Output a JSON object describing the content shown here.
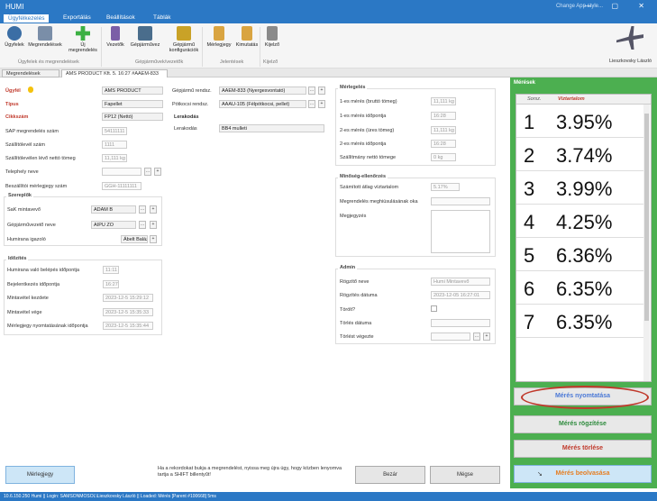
{
  "window": {
    "title": "HUMI",
    "user_text": "Change App style...",
    "controls": "— ▢ ✕"
  },
  "menu": {
    "items": [
      "Ügyfélkezelés",
      "Exportálás",
      "Beállítások",
      "Táblák"
    ]
  },
  "ribbon": {
    "buttons": [
      "Ügyfelek",
      "Megrendelések",
      "Új megrendelés",
      "Vezetők",
      "Gépjárművez",
      "Gépjármű konfigurációk",
      "Mérlegjegy",
      "Kimutatás",
      "Kijelző"
    ],
    "groups": [
      "Ügyfelek és megrendelések",
      "Gépjárművek/vezetők",
      "Jelentések",
      "Kijelző"
    ],
    "user": "Lieszkovsky László"
  },
  "tabs": [
    "Megrendelések",
    "AMS PRODUCT Kft. 5. 16:27 #AAEM-833"
  ],
  "form": {
    "ugyfel_label": "Ügyfél",
    "ugyfel_value": "AMS PRODUCT",
    "tipus_label": "Típus",
    "tipus_value": "Fapellet",
    "cikkszam_label": "Cikkszám",
    "cikkszam_value": "FP12 (Nettó)",
    "sap_label": "SAP megrendelés szám",
    "sap_value": "54111111",
    "szall_label": "Szállítólevél szám",
    "szall_value": "1111",
    "szallnetto_label": "Szállítólevélen lévő nettó tömeg",
    "szallnetto_value": "11,111 kg",
    "telephely_label": "Telephely neve",
    "beszall_label": "Beszállítói mérlegjegy szám",
    "beszall_value": "GGH-11111111",
    "szereplok_title": "Szereplők",
    "sap_mintavevo_label": "SaK mintavevő",
    "sap_mintavevo_value": "ADAM B",
    "gepjarmuvezeto_label": "Gépjárművezető neve",
    "gepjarmuvezeto_value": "AIPU ZO",
    "humirana_label": "Humirana igazoló",
    "humirana_value": "Ábelt Balázs",
    "gepjarmu_rendsz_label": "Gépjármű rendsz.",
    "gepjarmu_rendsz_value": "AAEM-833 (Nyergesvontató)",
    "potkocsi_label": "Pótkocsi rendsz.",
    "potkocsi_value": "AAAU-105 (Félpótkocsi, pellet)",
    "lerakodas_title": "Lerakodás",
    "lerakodo_label": "Lerakodás",
    "lerakodo_value": "BB4 mulleti",
    "idozites_title": "Időzítés",
    "hb_label": "Humirana való belépés időpontja",
    "hb_value": "11:11",
    "bej_label": "Bejelentkezés időpontja",
    "bej_value": "16:27",
    "mk_label": "Mintavétel kezdete",
    "mk_value": "2023-12-5 15:29:12",
    "mv_label": "Mintavétel vége",
    "mv_value": "2023-12-5 15:35:33",
    "mny_label": "Mérlegjegy nyomtatásának időpontja",
    "mny_value": "2023-12-5 15:35:44"
  },
  "merlegeles": {
    "title": "Mérlegelés",
    "rows": [
      {
        "label": "1-es mérés (bruttó tömeg)",
        "value": "11,111 kg"
      },
      {
        "label": "1-es mérés időpontja",
        "value": "16:28"
      },
      {
        "label": "2-es mérés (üres tömeg)",
        "value": "11,111 kg"
      },
      {
        "label": "2-es mérés időpontja",
        "value": "16:28"
      },
      {
        "label": "Szállítmány nettó tömege",
        "value": "0 kg"
      }
    ]
  },
  "minoseg": {
    "title": "Minőség-ellenőrzés",
    "atlag_label": "Számított átlag víztartalom",
    "atlag_value": "5.17%",
    "megr_label": "Megrendelés meghiúsulásának oka",
    "megjegyzes_label": "Megjegyzés"
  },
  "admin": {
    "title": "Admin",
    "rogzito_label": "Rögzítő neve",
    "rogzito_value": "Humi Mintavevő",
    "rogzites_label": "Rögzítés dátuma",
    "rogzites_value": "2023-12-05 16:27:01",
    "torolt_label": "Törölt?",
    "torles_label": "Törlés dátuma",
    "torlest_label": "Törlést végezte"
  },
  "meresek": {
    "title": "Mérések",
    "col_sorsz": "Sorsz.",
    "col_viz": "Víztartalom",
    "rows": [
      {
        "n": "1",
        "v": "3.95%"
      },
      {
        "n": "2",
        "v": "3.74%"
      },
      {
        "n": "3",
        "v": "3.99%"
      },
      {
        "n": "4",
        "v": "4.25%"
      },
      {
        "n": "5",
        "v": "6.36%"
      },
      {
        "n": "6",
        "v": "6.35%"
      },
      {
        "n": "7",
        "v": "6.35%"
      }
    ]
  },
  "buttons": {
    "nyomtatas": "Mérés nyomtatása",
    "rogzites": "Mérés rögzítése",
    "torles": "Mérés törlése",
    "beolvasas": "Mérés beolvasása",
    "merlegjegy": "Mérlegjegy",
    "bezar": "Bezár",
    "megse": "Mégse"
  },
  "notice": "Ha a rekordokat bukja a megrendelést, nyissa meg újra úgy, hogy közben lenyomva tartja a SHIFT billentyűt!",
  "status": "10.6.150.250 Humi || Login: SAMSONMOSOL\\Lieszkovsky László || Loaded: Mérés [Parent #100668] 5ms",
  "colors": {
    "accent": "#2b78c5",
    "panel_green": "#4caf50",
    "print_blue": "#4a78d6",
    "save_green": "#2e8b3d",
    "delete_red": "#c0392b",
    "scan_orange": "#e67e22"
  }
}
